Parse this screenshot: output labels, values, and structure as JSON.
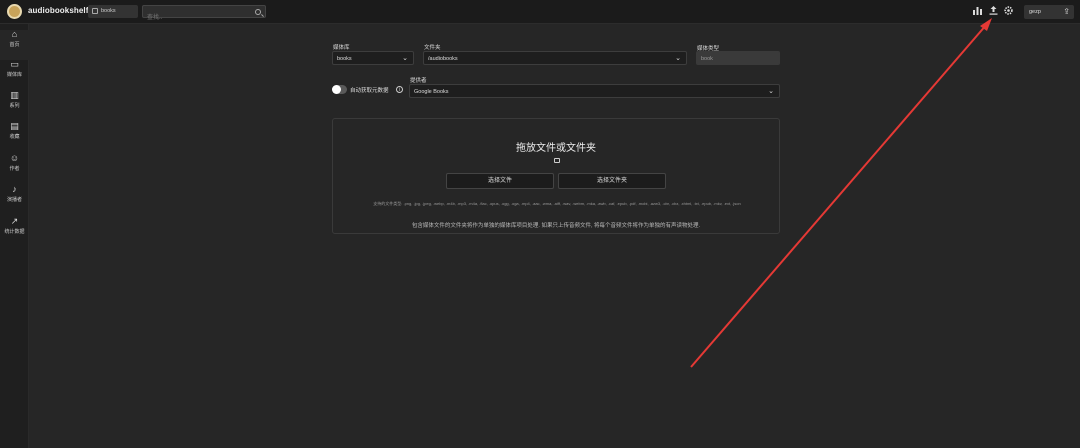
{
  "app": {
    "title": "audiobookshelf"
  },
  "header": {
    "library_select": "books",
    "search_placeholder": "查找..",
    "user_button": "gezp",
    "icons": [
      "stats-icon",
      "upload-icon",
      "settings-icon"
    ]
  },
  "sidebar": {
    "items": [
      {
        "label": "首页",
        "icon": "home-icon"
      },
      {
        "label": "媒体库",
        "icon": "library-icon"
      },
      {
        "label": "系列",
        "icon": "series-icon"
      },
      {
        "label": "收藏",
        "icon": "collections-icon"
      },
      {
        "label": "作者",
        "icon": "authors-icon"
      },
      {
        "label": "演播者",
        "icon": "narrators-icon"
      },
      {
        "label": "统计数据",
        "icon": "stats-icon"
      }
    ]
  },
  "form": {
    "library_label": "媒体库",
    "library_value": "books",
    "folder_label": "文件夹",
    "folder_value": "/audiobooks",
    "media_type_label": "媒体类型",
    "media_type_value": "book",
    "auto_fetch_label": "自动获取元数据",
    "provider_label": "提供者",
    "provider_value": "Google Books"
  },
  "dropzone": {
    "title": "拖放文件或文件夹",
    "choose_files": "选择文件",
    "choose_folder": "选择文件夹",
    "supported_types": "支持的文件类型: .png, .jpg, .jpeg, .webp, .m4b, .mp3, .m4a, .flac, .opus, .ogg, .oga, .mp4, .aac, .wma, .aiff, .wav, .webm, .mka, .awb, .caf, .epub, .pdf, .mobi, .azw3, .cbr, .cbz, .xhtml, .txt, .epub, .mkv, .ext, .json",
    "note": "包含媒体文件的文件夹将作为单独的媒体库项目处理. 如果只上传音频文件, 将每个音频文件将作为单独的有声读物处理."
  },
  "colors": {
    "annotation_arrow": "#e53935",
    "background": "#262626",
    "topbar": "#1b1b1b"
  }
}
